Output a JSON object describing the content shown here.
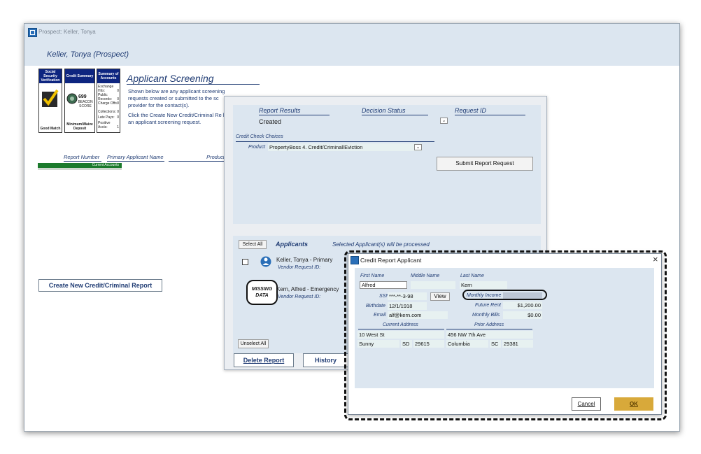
{
  "window": {
    "title": "Prospect: Keller, Tonya",
    "prospect_name": "Keller, Tonya (Prospect)"
  },
  "cards": {
    "ssn": {
      "header": "Social Security Verification",
      "footer": "Good Match"
    },
    "credit": {
      "header": "Credit Summary",
      "score": "699",
      "score_label": "BEACON SCORE",
      "footer": "Minimum/Waive Deposit"
    },
    "accounts": {
      "header": "Summary of Accounts",
      "rows": [
        {
          "label": "Exchange Hits:",
          "value": "0"
        },
        {
          "label": "Public Records:",
          "value": "0"
        },
        {
          "label": "Charge Offs:",
          "value": "0"
        },
        {
          "label": "Collections:",
          "value": "0"
        },
        {
          "label": "Late Pays:",
          "value": "0"
        },
        {
          "label": "Positive Accts:",
          "value": "1"
        }
      ]
    },
    "current_accounts": "Current Accounts"
  },
  "screening": {
    "title": "Applicant Screening",
    "desc1": "Shown below are any applicant screening requests created or submitted to the sc provider for the contact(s).",
    "desc2": "Click the Create New Credit/Criminal Re begin an applicant screening request.",
    "col_report_number": "Report Number",
    "col_primary_name": "Primary Applicant Name",
    "col_product": "Product",
    "create_button": "Create New Credit/Criminal Report"
  },
  "report_panel": {
    "report_results_label": "Report Results",
    "decision_status_label": "Decision Status",
    "request_id_label": "Request ID",
    "report_results_value": "Created",
    "credit_check_choices": "Credit Check Choices",
    "product_label": "Product",
    "product_value": "PropertyBoss 4. Credit/Criminal/Eviction",
    "submit_button": "Submit Report Request",
    "select_all": "Select All",
    "applicants_title": "Applicants",
    "applicants_note": "Selected Applicant(s) will be processed",
    "applicants": [
      {
        "name": "Keller, Tonya  - Primary",
        "vendor": "Vendor Request ID:"
      },
      {
        "name": "Kern, Alfred  - Emergency",
        "vendor": "Vendor Request ID:"
      }
    ],
    "missing_data": "MISSING DATA",
    "unselect_all": "Unselect All",
    "delete_button": "Delete Report",
    "history_button": "History"
  },
  "dialog": {
    "title": "Credit Report Applicant",
    "close": "×",
    "first_name_label": "First Name",
    "middle_name_label": "Middle Name",
    "last_name_label": "Last Name",
    "first_name": "Alfred",
    "middle_name": "",
    "last_name": "Kern",
    "ssn_label": "SSN",
    "ssn_value": "***-**-3-98",
    "view_button": "View",
    "birthdate_label": "Birthdate",
    "birthdate_value": "12/1/1918",
    "email_label": "Email",
    "email_value": "alf@kern.com",
    "monthly_income_label": "Monthly Income",
    "monthly_income_value": "",
    "future_rent_label": "Future Rent",
    "future_rent_value": "$1,200.00",
    "monthly_bills_label": "Monthly Bills",
    "monthly_bills_value": "$0.00",
    "current_address_label": "Current Address",
    "prior_address_label": "Prior Address",
    "current_street": "10 West St",
    "current_city": "Sunny",
    "current_state": "SD",
    "current_zip": "29615",
    "prior_street": "456 NW 7th Ave",
    "prior_city": "Columbia",
    "prior_state": "SC",
    "prior_zip": "29381",
    "cancel_button": "Cancel",
    "ok_button": "OK"
  },
  "colors": {
    "window_bg": "#dce6f0",
    "card_header": "#0d2580",
    "label_blue": "#1f3b73",
    "ok_button": "#d8a93a",
    "field_bg": "#e7f1f1"
  }
}
